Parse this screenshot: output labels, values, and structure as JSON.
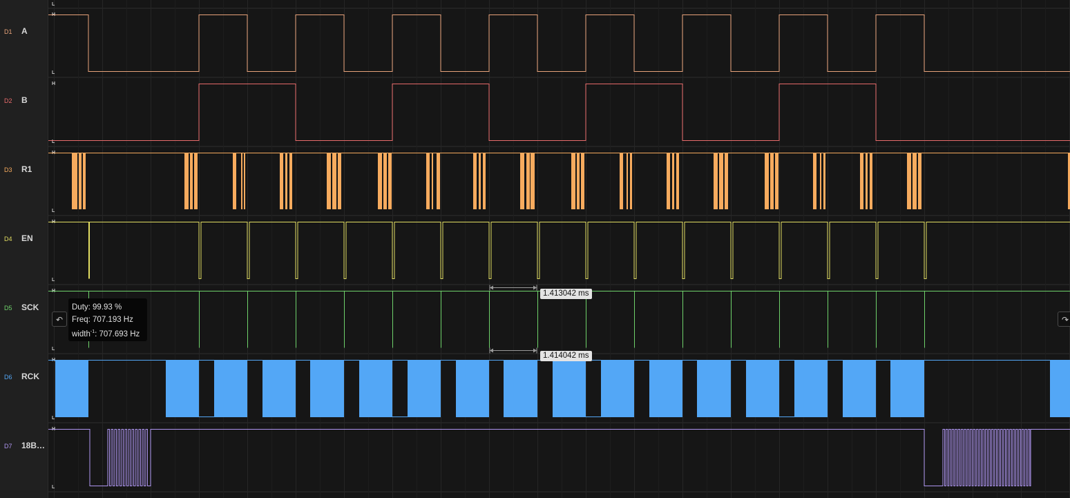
{
  "level_high": "H",
  "level_low": "L",
  "channels": [
    {
      "id": "D1",
      "name": "A",
      "color": "#e8a37a"
    },
    {
      "id": "D2",
      "name": "B",
      "color": "#e86b6b"
    },
    {
      "id": "D3",
      "name": "R1",
      "color": "#f7ab5e"
    },
    {
      "id": "D4",
      "name": "EN",
      "color": "#e3de62"
    },
    {
      "id": "D5",
      "name": "SCK",
      "color": "#6fd36b"
    },
    {
      "id": "D6",
      "name": "RCK",
      "color": "#53a7f6"
    },
    {
      "id": "D7",
      "name": "18B…",
      "color": "#ae95f0"
    }
  ],
  "tooltip": {
    "duty": "Duty: 99.93 %",
    "freq": "Freq: 707.193 Hz",
    "width_prefix": "width",
    "width_sup": "-1",
    "width_value": ": 707.693 Hz"
  },
  "measurements": {
    "m1": "1.413042 ms",
    "m2": "1.414042 ms"
  },
  "nav": {
    "prev_icon": "falling-edge-icon",
    "next_icon": "rising-edge-icon"
  }
}
